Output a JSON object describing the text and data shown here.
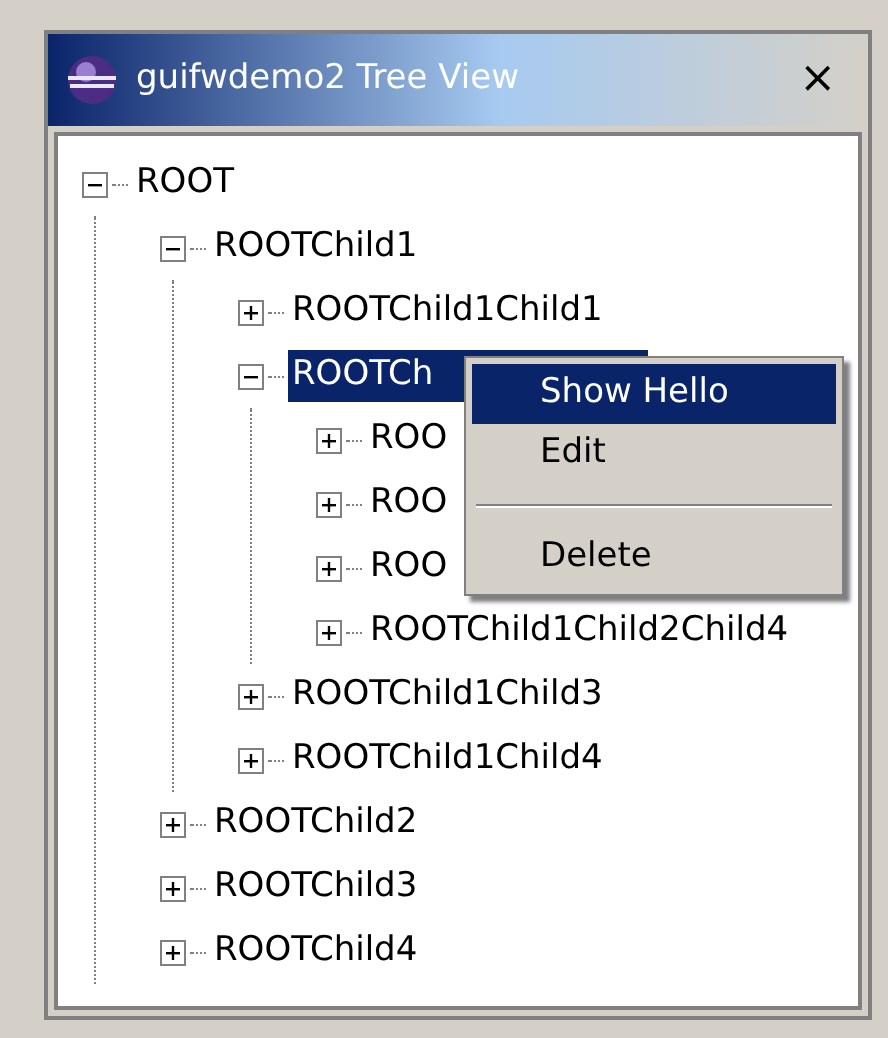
{
  "window": {
    "title": "guifwdemo2 Tree View",
    "close": "×"
  },
  "tree": [
    {
      "label": "ROOT",
      "expanded": true,
      "selected": false,
      "children": [
        {
          "label": "ROOTChild1",
          "expanded": true,
          "selected": false,
          "children": [
            {
              "label": "ROOTChild1Child1",
              "expanded": false,
              "selected": false
            },
            {
              "label": "ROOTCh",
              "expanded": true,
              "selected": true,
              "children": [
                {
                  "label": "ROO",
                  "expanded": false,
                  "selected": false
                },
                {
                  "label": "ROO",
                  "expanded": false,
                  "selected": false
                },
                {
                  "label": "ROO",
                  "expanded": false,
                  "selected": false
                },
                {
                  "label": "ROOTChild1Child2Child4",
                  "expanded": false,
                  "selected": false
                }
              ]
            },
            {
              "label": "ROOTChild1Child3",
              "expanded": false,
              "selected": false
            },
            {
              "label": "ROOTChild1Child4",
              "expanded": false,
              "selected": false
            }
          ]
        },
        {
          "label": "ROOTChild2",
          "expanded": false,
          "selected": false
        },
        {
          "label": "ROOTChild3",
          "expanded": false,
          "selected": false
        },
        {
          "label": "ROOTChild4",
          "expanded": false,
          "selected": false
        }
      ]
    }
  ],
  "context_menu": {
    "items": [
      {
        "kind": "item",
        "label": "Show Hello",
        "selected": true
      },
      {
        "kind": "item",
        "label": "Edit",
        "selected": false
      },
      {
        "kind": "separator"
      },
      {
        "kind": "item",
        "label": "Delete",
        "selected": false
      }
    ]
  }
}
